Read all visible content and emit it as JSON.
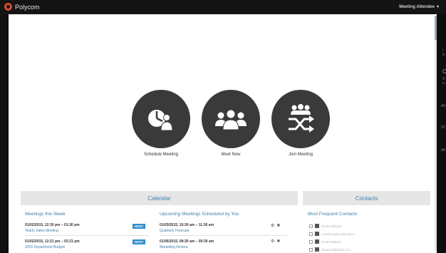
{
  "app": {
    "brand": "Polycom",
    "user_menu": "Meeting Attendee",
    "caret": "▾"
  },
  "actions": [
    {
      "label": "Schedule Meeting",
      "icon": "schedule-meeting-icon"
    },
    {
      "label": "Meet Now",
      "icon": "group-icon"
    },
    {
      "label": "Join Meeting",
      "icon": "shuffle-icon"
    }
  ],
  "calendar": {
    "title": "Calendar",
    "week_title": "Meetings this Week",
    "upcoming_title": "Upcoming Meetings Scheduled by You",
    "week_meetings": [
      {
        "time": "01/02/2015, 12:30 pm – 01:30 pm",
        "name": "Yearly Sales Meeting",
        "badge": "HOST"
      },
      {
        "time": "01/02/2015, 12:21 pm – 02:21 pm",
        "name": "2015 Department Budget",
        "badge": "HOST"
      }
    ],
    "upcoming_meetings": [
      {
        "time": "01/03/2015, 10:30 am – 11:30 am",
        "name": "Quarterly Forecast"
      },
      {
        "time": "01/06/2015, 08:30 am – 09:30 am",
        "name": "Marketing Review"
      }
    ]
  },
  "contacts": {
    "title": "Contacts",
    "frequent_title": "Most Frequent Contacts",
    "items": [
      {
        "name": "David Spillane"
      },
      {
        "name": "jonathanspear@polyco..."
      },
      {
        "name": "Scott Watkins"
      },
      {
        "name": "ckawana@swift.com"
      }
    ]
  },
  "right_strip": {
    "letters": [
      "I",
      "d",
      "C",
      "S",
      "n",
      "AV",
      "ST",
      "AV"
    ]
  },
  "colors": {
    "accent": "#3f7ea9",
    "host_badge": "#2f8fd0",
    "circle": "#3a3a3a",
    "brand": "#d84a2e"
  }
}
